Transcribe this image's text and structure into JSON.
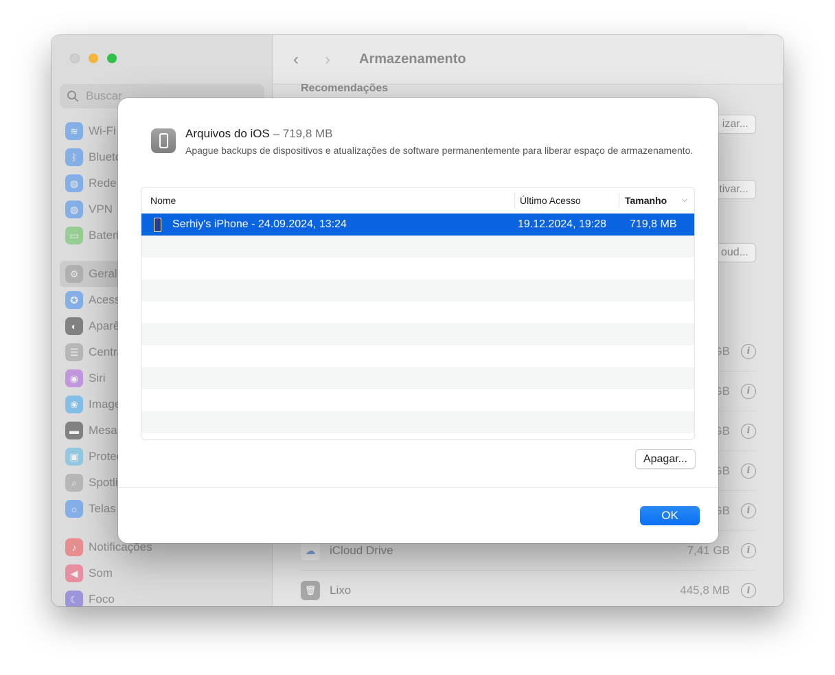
{
  "window": {
    "title": "Armazenamento",
    "search_placeholder": "Buscar",
    "sidebar": {
      "group1": [
        {
          "label": "Wi-Fi",
          "icon": "wifi-icon",
          "color": "#3d8cf0",
          "glyph": "≋"
        },
        {
          "label": "Bluetooth",
          "icon": "bluetooth-icon",
          "color": "#3d8cf0",
          "glyph": "ᛒ"
        },
        {
          "label": "Rede",
          "icon": "globe-icon",
          "color": "#3d8cf0",
          "glyph": "◍"
        },
        {
          "label": "VPN",
          "icon": "vpn-icon",
          "color": "#3d8cf0",
          "glyph": "◍"
        },
        {
          "label": "Bateria",
          "icon": "battery-icon",
          "color": "#5fc45a",
          "glyph": "▭"
        }
      ],
      "group2": [
        {
          "label": "Geral",
          "icon": "gear-icon",
          "color": "#9a9a9a",
          "glyph": "⚙",
          "selected": true
        },
        {
          "label": "Acessibilidade",
          "icon": "accessibility-icon",
          "color": "#3d8cf0",
          "glyph": "✪"
        },
        {
          "label": "Aparência",
          "icon": "appearance-icon",
          "color": "#3a3a3a",
          "glyph": "◐"
        },
        {
          "label": "Central de Controle",
          "icon": "control-center-icon",
          "color": "#9a9a9a",
          "glyph": "☰"
        },
        {
          "label": "Siri",
          "icon": "siri-icon",
          "color": "#b060e0",
          "glyph": "◉"
        },
        {
          "label": "Imagem de Fundo",
          "icon": "wallpaper-icon",
          "color": "#3da8f0",
          "glyph": "❀"
        },
        {
          "label": "Mesa e Dock",
          "icon": "dock-icon",
          "color": "#3a3a3a",
          "glyph": "▬"
        },
        {
          "label": "Proteção de Tela",
          "icon": "screensaver-icon",
          "color": "#56b8e8",
          "glyph": "▣"
        },
        {
          "label": "Spotlight",
          "icon": "spotlight-icon",
          "color": "#9a9a9a",
          "glyph": "⌕"
        },
        {
          "label": "Telas",
          "icon": "displays-icon",
          "color": "#3d8cf0",
          "glyph": "☼"
        }
      ],
      "group3": [
        {
          "label": "Notificações",
          "icon": "bell-icon",
          "color": "#f05050",
          "glyph": "♪"
        },
        {
          "label": "Som",
          "icon": "speaker-icon",
          "color": "#f05070",
          "glyph": "◀"
        },
        {
          "label": "Foco",
          "icon": "moon-icon",
          "color": "#6a5cd8",
          "glyph": "☾"
        }
      ]
    },
    "recommendations_header": "Recomendações",
    "rec_buttons": [
      "izar...",
      "tivar...",
      "oud..."
    ],
    "storage_rows": [
      {
        "name": "",
        "size": "GB"
      },
      {
        "name": "",
        "size": "GB"
      },
      {
        "name": "",
        "size": "GB"
      },
      {
        "name": "",
        "size": "GB"
      },
      {
        "name": "",
        "size": "GB"
      },
      {
        "name": "iCloud Drive",
        "size": "7,41 GB",
        "icon": "cloud-icon"
      },
      {
        "name": "Lixo",
        "size": "445,8 MB",
        "icon": "trash-icon"
      }
    ]
  },
  "sheet": {
    "title": "Arquivos do iOS",
    "size": " – 719,8 MB",
    "description": "Apague backups de dispositivos e atualizações de software permanentemente para liberar espaço de armazenamento.",
    "columns": {
      "name": "Nome",
      "access": "Último Acesso",
      "size": "Tamanho"
    },
    "rows": [
      {
        "name": "Serhiy's iPhone - 24.09.2024, 13:24",
        "access": "19.12.2024, 19:28",
        "size": "719,8 MB"
      }
    ],
    "empty_rows": 9,
    "erase_button": "Apagar...",
    "ok_button": "OK"
  }
}
